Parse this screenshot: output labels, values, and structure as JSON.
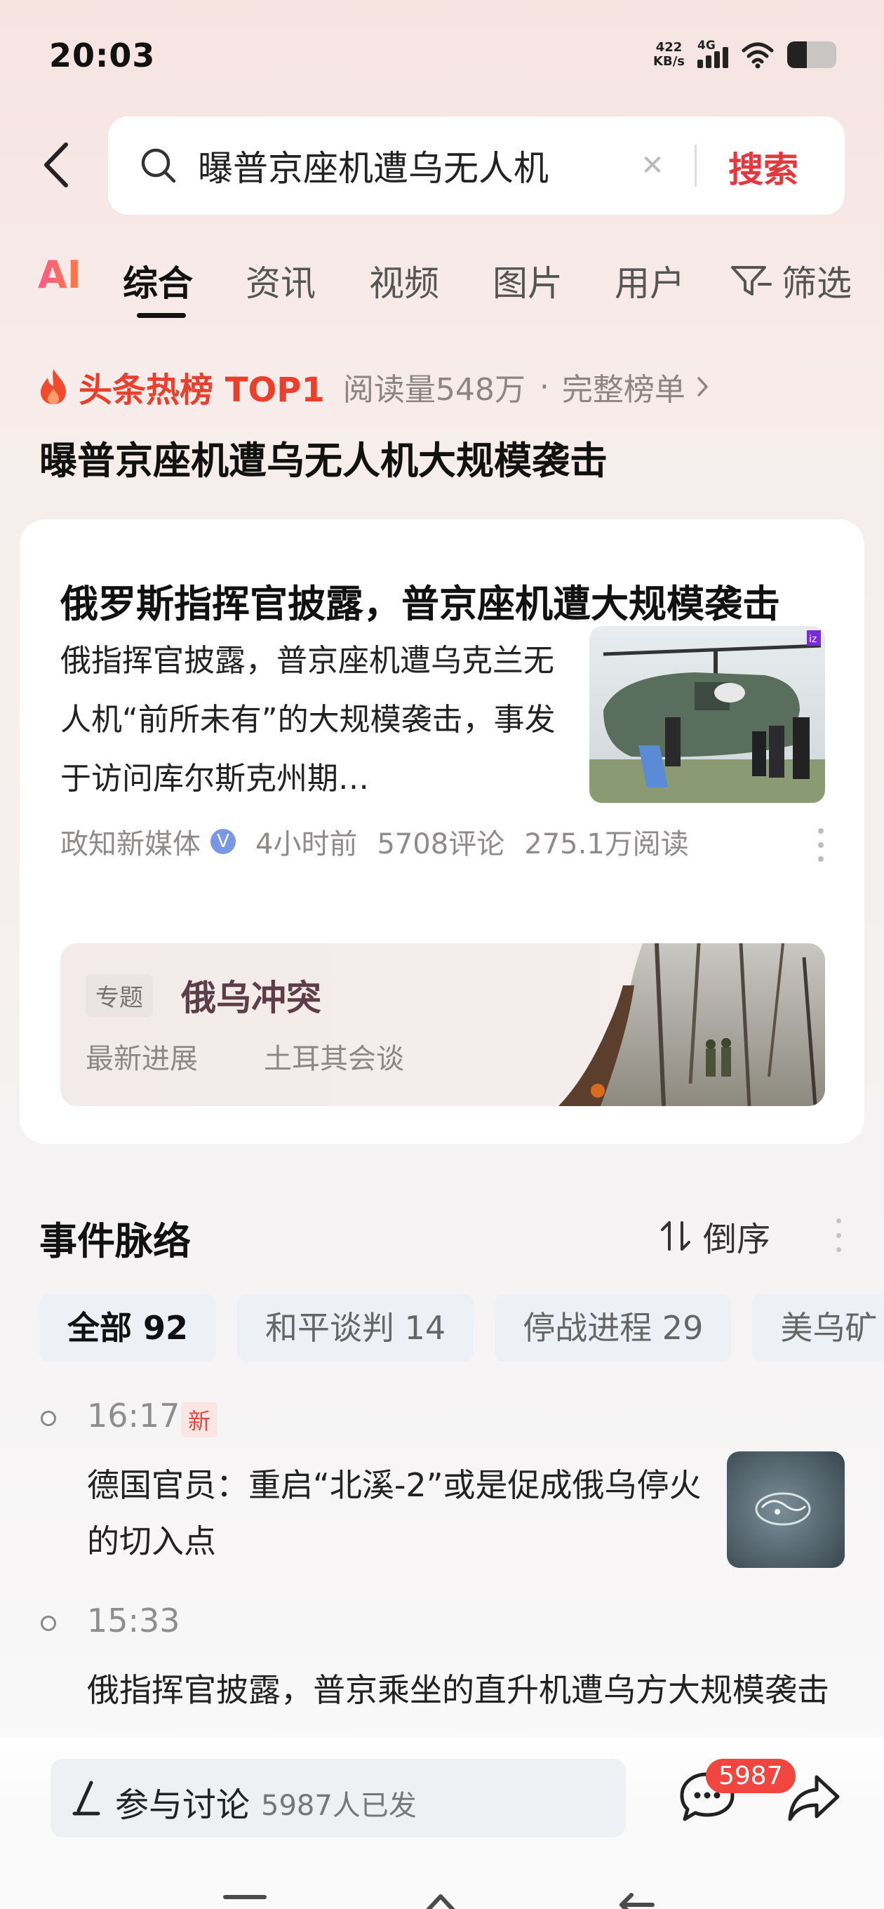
{
  "status_bar": {
    "time": "20:03",
    "net_speed_value": "422",
    "net_speed_unit": "KB/s",
    "network": "4G",
    "battery_level": 0.4
  },
  "search": {
    "query": "曝普京座机遭乌无人机",
    "submit_label": "搜索"
  },
  "tabs": {
    "ai_label": "AI",
    "items": [
      "综合",
      "资讯",
      "视频",
      "图片",
      "用户"
    ],
    "active": "综合",
    "filter_label": "筛选"
  },
  "hot_rank": {
    "label": "头条热榜 TOP1",
    "reads": "阅读量548万",
    "separator": "·",
    "full_list": "完整榜单",
    "title": "曝普京座机遭乌无人机大规模袭击"
  },
  "article": {
    "title": "俄罗斯指挥官披露，普京座机遭大规模袭击",
    "summary": "俄指挥官披露，普京座机遭乌克兰无人机“前所未有”的大规模袭击，事发于访问库尔斯克州期…",
    "source": "政知新媒体",
    "verified_mark": "V",
    "time_ago": "4小时前",
    "comments": "5708评论",
    "reads": "275.1万阅读",
    "thumb_watermark": "iz"
  },
  "topic": {
    "tag": "专题",
    "title": "俄乌冲突",
    "links": [
      "最新进展",
      "土耳其会谈"
    ]
  },
  "timeline": {
    "title": "事件脉络",
    "sort_label": "倒序",
    "chips": [
      "全部 92",
      "和平谈判 14",
      "停战进程 29",
      "美乌矿"
    ],
    "active_chip": "全部 92",
    "items": [
      {
        "time": "16:17",
        "badge": "新",
        "text": "德国官员：重启“北溪-2”或是促成俄乌停火的切入点"
      },
      {
        "time": "15:33",
        "badge": "",
        "text": "俄指挥官披露，普京乘坐的直升机遭乌方大规模袭击"
      }
    ]
  },
  "bottom_bar": {
    "discuss_label": "参与讨论",
    "discuss_count": "5987人已发",
    "comment_badge": "5987"
  },
  "colors": {
    "accent_red": "#e3393e",
    "hot_orange": "#e8402c",
    "badge_red": "#f0463f",
    "topic_title": "#5c3d49"
  }
}
